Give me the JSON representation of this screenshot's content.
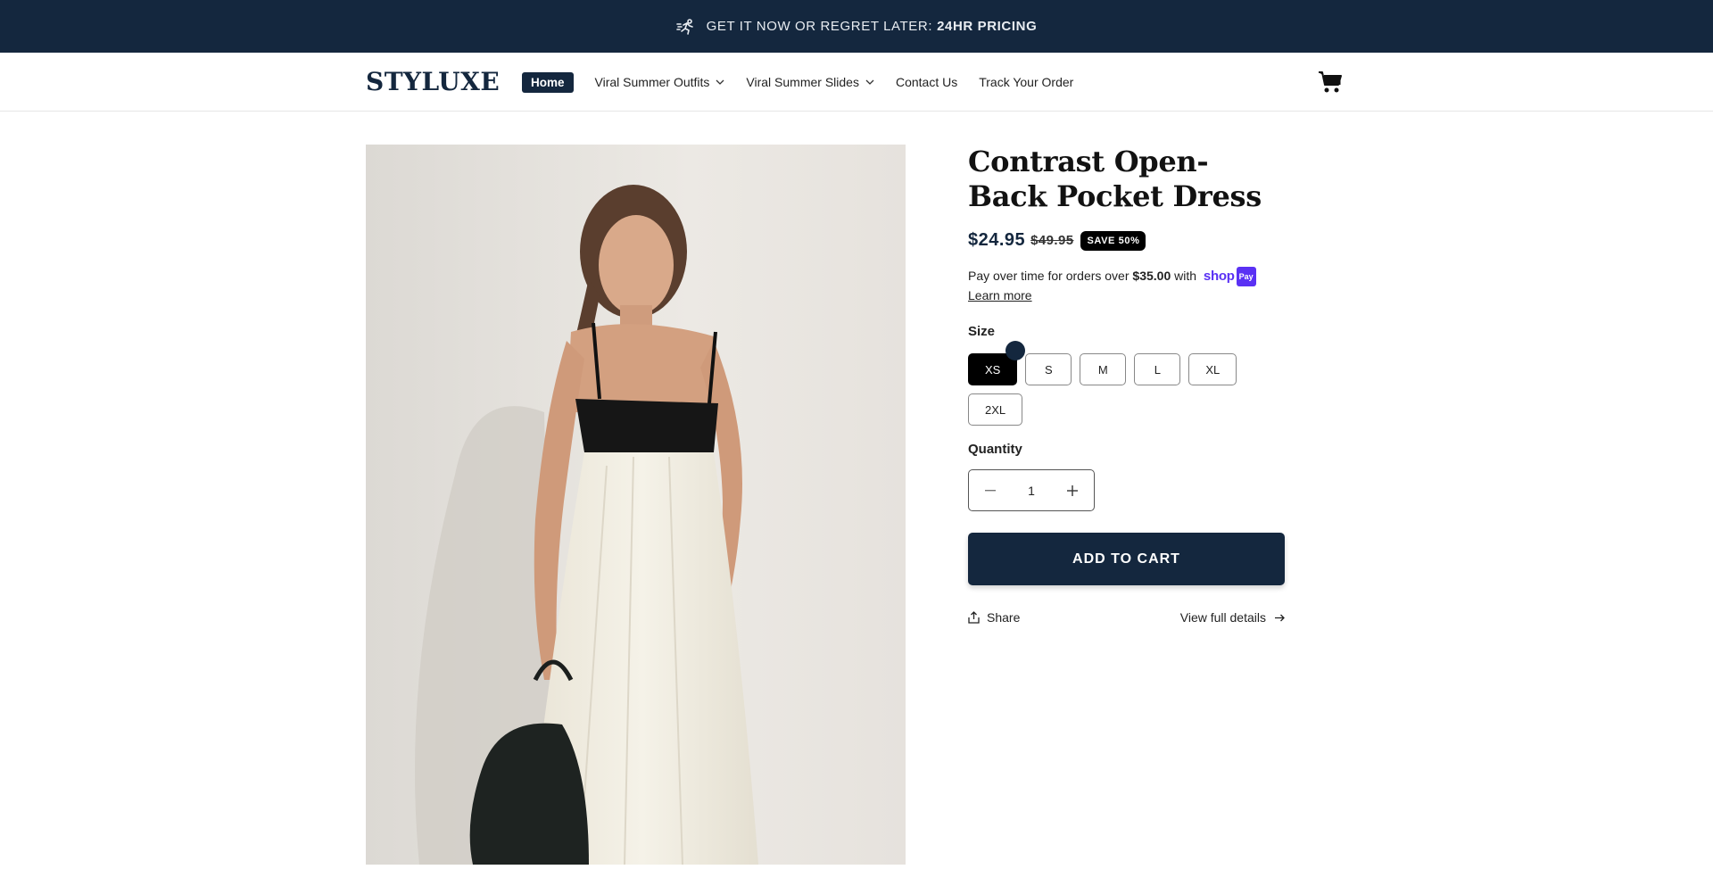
{
  "announcement": {
    "icon": "runner-icon",
    "text": "GET IT NOW OR REGRET LATER:",
    "highlight": "24HR PRICING"
  },
  "header": {
    "logo": "STYLUXE",
    "nav": {
      "home": "Home",
      "outfits": "Viral Summer Outfits",
      "slides": "Viral Summer Slides",
      "contact": "Contact Us",
      "track": "Track Your Order"
    },
    "cart_icon": "cart-icon"
  },
  "product": {
    "title": "Contrast Open-Back Pocket Dress",
    "price": "$24.95",
    "compare_price": "$49.95",
    "badge": "SAVE 50%",
    "installments": {
      "prefix": "Pay over time for orders over",
      "amount": "$35.00",
      "suffix": "with",
      "brand": "shop",
      "brand_pill": "Pay",
      "learn_more": "Learn more"
    },
    "size_label": "Size",
    "sizes": [
      "XS",
      "S",
      "M",
      "L",
      "XL",
      "2XL"
    ],
    "selected_size": "XS",
    "quantity_label": "Quantity",
    "quantity": "1",
    "add_to_cart": "ADD TO CART",
    "share": "Share",
    "view_details": "View full details"
  },
  "colors": {
    "brand": "#14273e",
    "shop_pay": "#5a31f4"
  }
}
